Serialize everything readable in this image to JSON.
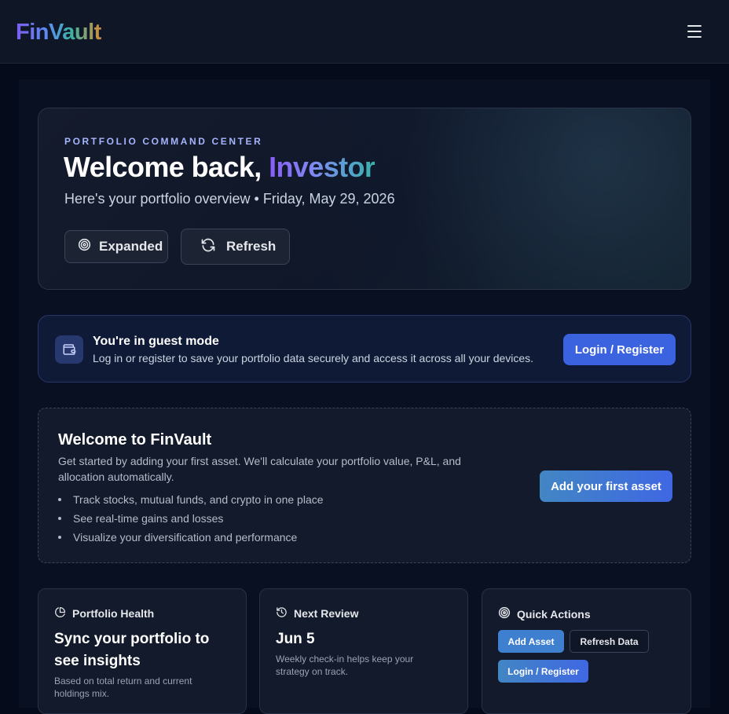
{
  "header": {
    "logo": "FinVault",
    "menu_icon": "hamburger-menu-icon"
  },
  "hero": {
    "kicker": "PORTFOLIO COMMAND CENTER",
    "title_prefix": "Welcome back, ",
    "title_accent": "Investor",
    "subtitle": "Here's your portfolio overview • Friday, May 29, 2026",
    "expanded_label": "Expanded",
    "expanded_icon": "target-icon",
    "refresh_label": "Refresh",
    "refresh_icon": "refresh-icon"
  },
  "guest": {
    "icon": "wallet-icon",
    "title": "You're in guest mode",
    "description": "Log in or register to save your portfolio data securely and access it across all your devices.",
    "button": "Login / Register"
  },
  "welcome": {
    "title": "Welcome to FinVault",
    "description": "Get started by adding your first asset. We'll calculate your portfolio value, P&L, and allocation automatically.",
    "bullets": [
      "Track stocks, mutual funds, and crypto in one place",
      "See real-time gains and losses",
      "Visualize your diversification and performance"
    ],
    "button": "Add your first asset"
  },
  "cards": {
    "health": {
      "icon": "pie-chart-icon",
      "label": "Portfolio Health",
      "headline": "Sync your portfolio to see insights",
      "note": "Based on total return and current holdings mix."
    },
    "review": {
      "icon": "history-icon",
      "label": "Next Review",
      "headline": "Jun 5",
      "note": "Weekly check-in helps keep your strategy on track."
    },
    "actions": {
      "icon": "target-icon",
      "label": "Quick Actions",
      "add_asset": "Add Asset",
      "refresh_data": "Refresh Data",
      "login_register": "Login / Register"
    }
  },
  "colors": {
    "background": "#050b1a",
    "accent_blue": "#3b63e0",
    "accent_purple": "#8b5cf6",
    "accent_teal": "#38b2ac"
  }
}
